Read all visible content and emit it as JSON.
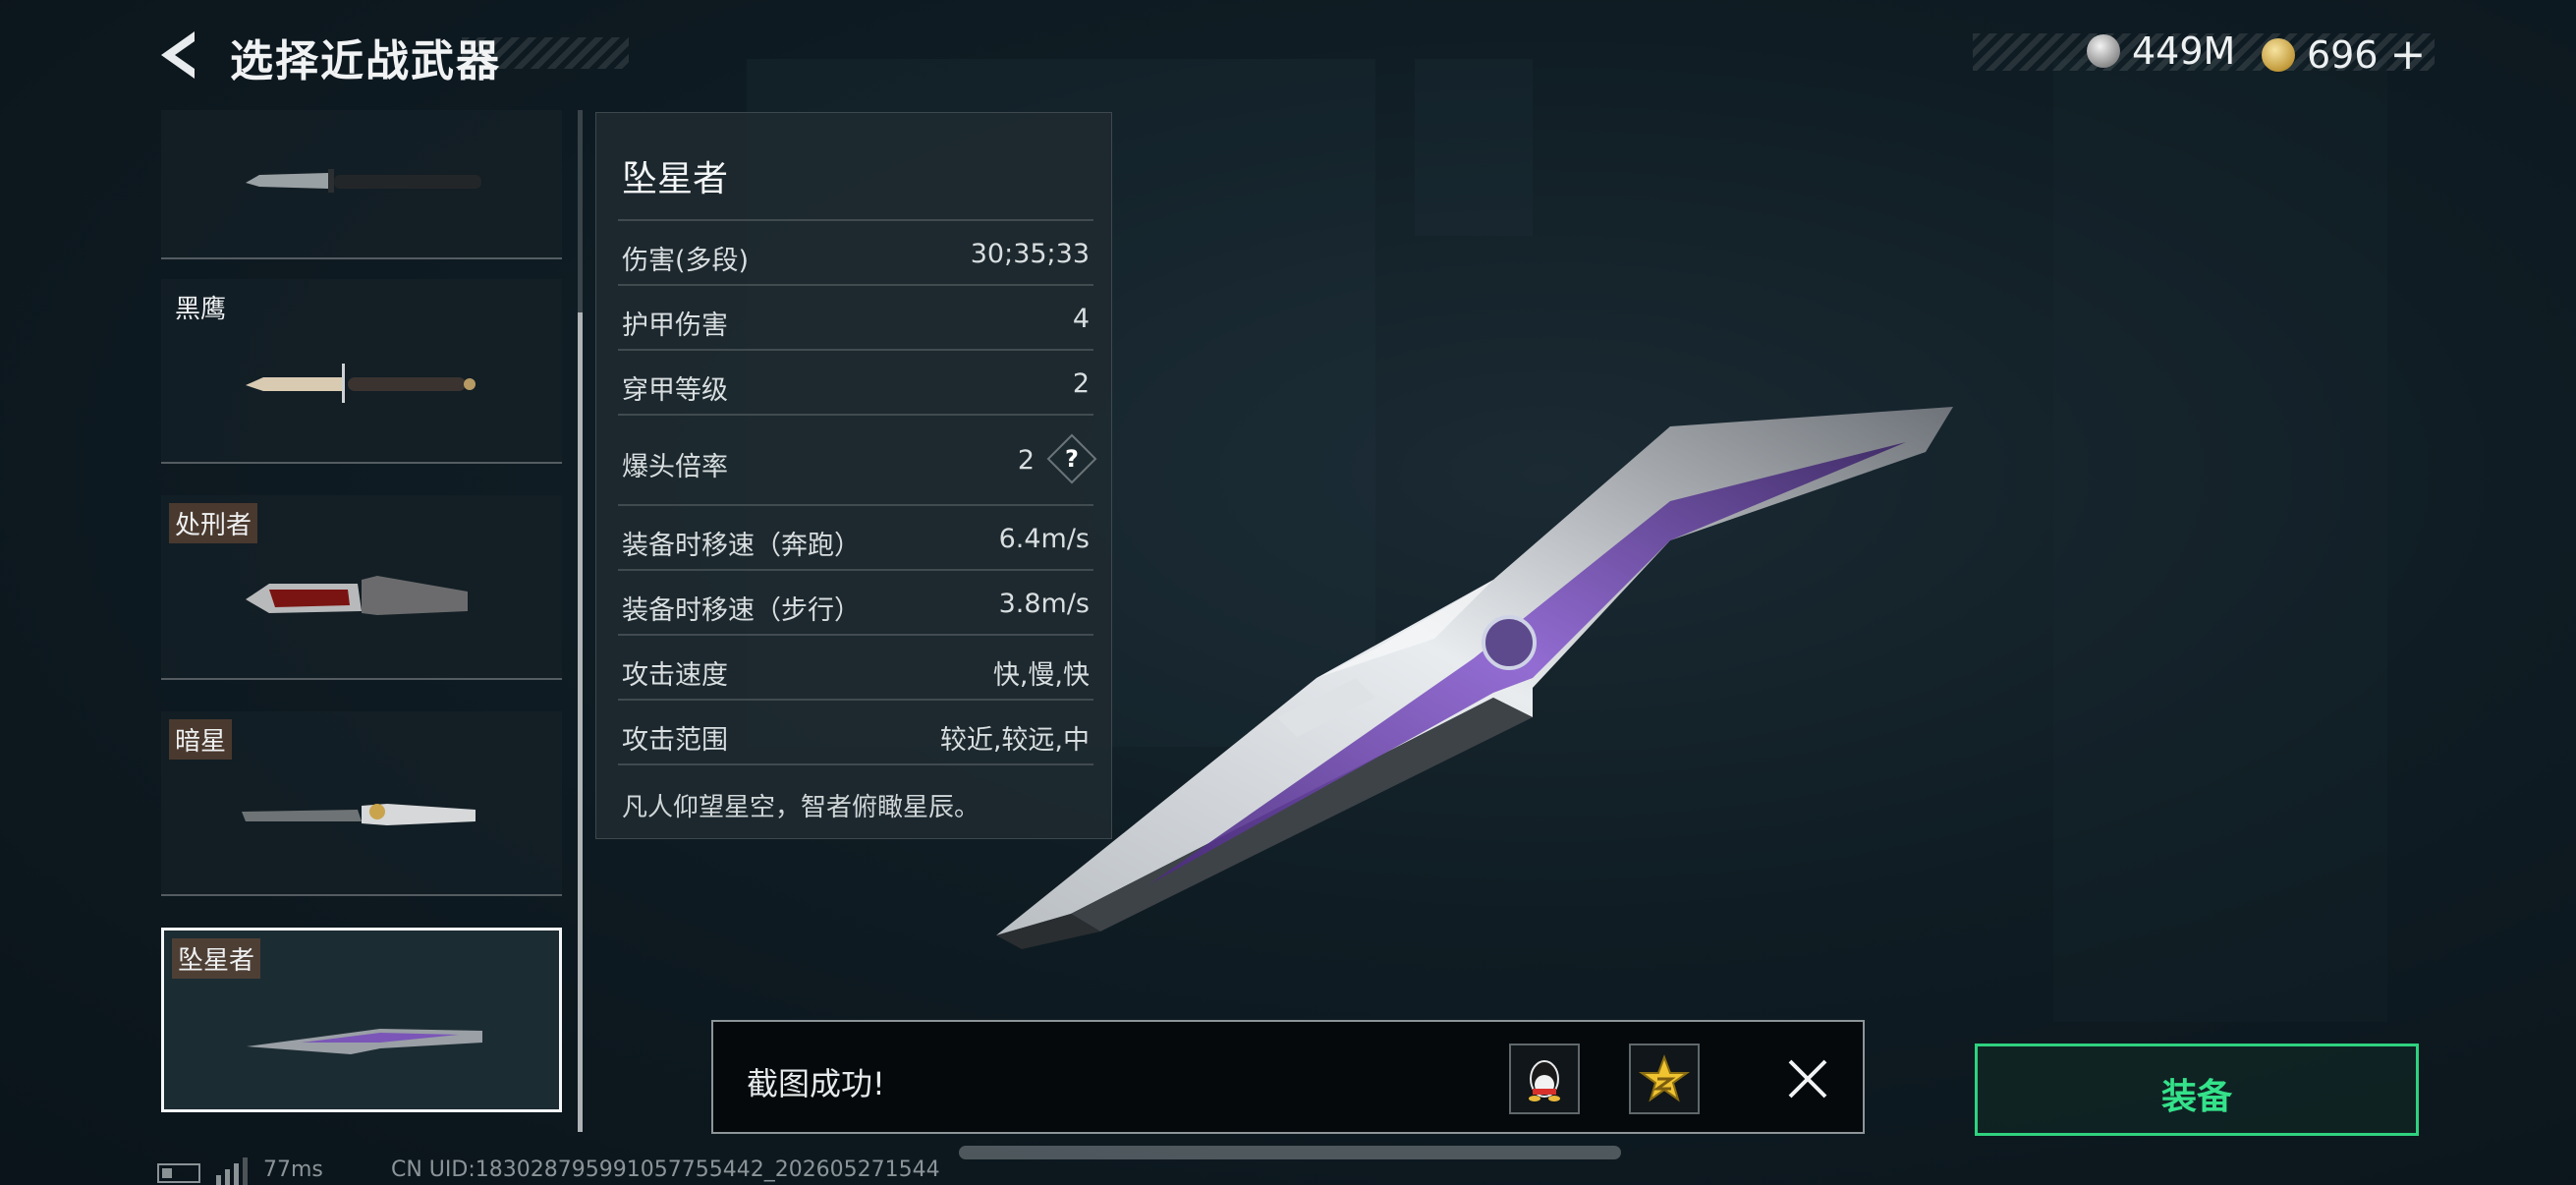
{
  "header": {
    "title": "选择近战武器",
    "currency": [
      {
        "icon": "silver-coin-icon",
        "value": "449M"
      },
      {
        "icon": "gold-coin-icon",
        "value": "696",
        "add": "+"
      }
    ]
  },
  "weapon_list": {
    "items": [
      {
        "name": "",
        "selected": false
      },
      {
        "name": "黑鹰",
        "selected": false
      },
      {
        "name": "处刑者",
        "selected": false
      },
      {
        "name": "暗星",
        "selected": false
      },
      {
        "name": "坠星者",
        "selected": true
      }
    ]
  },
  "stats_panel": {
    "name": "坠星者",
    "rows": [
      {
        "label": "伤害(多段)",
        "value": "30;35;33"
      },
      {
        "label": "护甲伤害",
        "value": "4"
      },
      {
        "label": "穿甲等级",
        "value": "2"
      },
      {
        "label": "爆头倍率",
        "value": "2",
        "help": "?"
      },
      {
        "label": "装备时移速（奔跑）",
        "value": "6.4m/s"
      },
      {
        "label": "装备时移速（步行）",
        "value": "3.8m/s"
      },
      {
        "label": "攻击速度",
        "value": "快,慢,快"
      },
      {
        "label": "攻击范围",
        "value": "较近,较远,中"
      }
    ],
    "description": "凡人仰望星空，智者俯瞰星辰。"
  },
  "toast": {
    "text": "截图成功!",
    "share": [
      "qq-icon",
      "qzone-star-icon"
    ],
    "close_icon": "close-icon"
  },
  "equip_button": {
    "label": "装备",
    "color": "#34e28a"
  },
  "footer": {
    "ping": "77ms",
    "uid": "CN UID:183028795991057755442_202605271544"
  }
}
